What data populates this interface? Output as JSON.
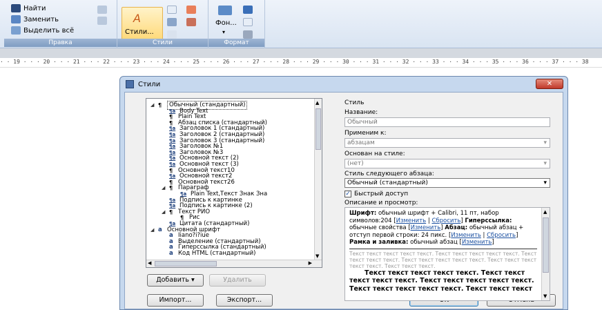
{
  "ribbon": {
    "edit": {
      "find": "Найти",
      "replace": "Заменить",
      "select_all": "Выделить всё",
      "label": "Правка"
    },
    "styles": {
      "button": "Стили...",
      "label": "Стили"
    },
    "format": {
      "background": "Фон...",
      "label": "Формат"
    }
  },
  "ruler": "· · 19 · · · 20 · · · 21 · · · 22 · · · 23 · · · 24 · · · 25 · · · 26 · · · 27 · · · 28 · · · 29 · · · 30 · · · 31 · · · 32 · · · 33 · · · 34 · · · 35 · · · 36 · · · 37 · · · 38",
  "dialog": {
    "title": "Стили",
    "close": "✕",
    "tree": [
      {
        "label": "Обычный (стандартный)",
        "kind": "para",
        "indent": 0,
        "twist": "◢",
        "selected": true
      },
      {
        "label": "Body Text",
        "kind": "char",
        "indent": 1
      },
      {
        "label": "Plain Text",
        "kind": "para",
        "indent": 1
      },
      {
        "label": "Абзац списка (стандартный)",
        "kind": "para",
        "indent": 1
      },
      {
        "label": "Заголовок 1 (стандартный)",
        "kind": "char",
        "indent": 1
      },
      {
        "label": "Заголовок 2 (стандартный)",
        "kind": "char",
        "indent": 1
      },
      {
        "label": "Заголовок 3 (стандартный)",
        "kind": "char",
        "indent": 1
      },
      {
        "label": "Заголовок №1",
        "kind": "char",
        "indent": 1
      },
      {
        "label": "Заголовок №3",
        "kind": "char",
        "indent": 1
      },
      {
        "label": "Основной текст (2)",
        "kind": "char",
        "indent": 1
      },
      {
        "label": "Основной текст (3)",
        "kind": "char",
        "indent": 1
      },
      {
        "label": "Основной текст10",
        "kind": "para",
        "indent": 1
      },
      {
        "label": "Основной текст2",
        "kind": "char",
        "indent": 1
      },
      {
        "label": "Основной текст26",
        "kind": "para",
        "indent": 1
      },
      {
        "label": "Параграф",
        "kind": "para",
        "indent": 1,
        "twist": "◢"
      },
      {
        "label": "Plain Text,Текст Знак Зна",
        "kind": "char",
        "indent": 2
      },
      {
        "label": "Подпись к картинке",
        "kind": "char",
        "indent": 1
      },
      {
        "label": "Подпись к картинке (2)",
        "kind": "char",
        "indent": 1
      },
      {
        "label": "Текст РИО",
        "kind": "para",
        "indent": 1,
        "twist": "◢"
      },
      {
        "label": "Рис",
        "kind": "para",
        "indent": 2
      },
      {
        "label": "Цитата (стандартный)",
        "kind": "char",
        "indent": 1
      },
      {
        "label": "Основной шрифт",
        "kind": "a",
        "indent": 0,
        "twist": "◢"
      },
      {
        "label": "Iiano?i?iue",
        "kind": "a",
        "indent": 1
      },
      {
        "label": "Выделение (стандартный)",
        "kind": "a",
        "indent": 1
      },
      {
        "label": "Гиперссылка (стандартный)",
        "kind": "a",
        "indent": 1
      },
      {
        "label": "Код HTML (стандартный)",
        "kind": "a",
        "indent": 1
      }
    ],
    "buttons": {
      "add": "Добавить ▾",
      "delete": "Удалить",
      "import": "Импорт...",
      "export": "Экспорт...",
      "ok": "OK",
      "cancel": "Отмена"
    },
    "style_panel": {
      "group_title": "Стиль",
      "name_label": "Название:",
      "name_value": "Обычный",
      "apply_label": "Применим к:",
      "apply_value": "абзацам",
      "based_label": "Основан на стиле:",
      "based_value": "(нет)",
      "next_label": "Стиль следующего абзаца:",
      "next_value": "Обычный (стандартный)",
      "quick_access": "Быстрый доступ",
      "desc_label": "Описание и просмотр:"
    },
    "description": {
      "font_b": "Шрифт:",
      "font_t": " обычный шрифт + Calibri, 11 пт, набор символов:204 ",
      "change": "Изменить",
      "reset": "Сбросить",
      "hyper_b": "Гиперссылка:",
      "hyper_t": " обычные свойства ",
      "para_b": "Абзац:",
      "para_t": " обычный абзац + отступ первой строки: 24 пикс. ",
      "frame_b": "Рамка и заливка:",
      "frame_t": " обычный абзац ",
      "grey": "Текст текст текст текст текст. Текст текст текст текст текст. Текст текст текст текст. Текст текст текст текст текст. Текст текст текст текст текст. Текст текст текст.",
      "preview_first": "Текст текст текст текст текст. Текст",
      "preview_rest": "текст текст текст текст. Текст текст текст текст текст. Текст текст текст текст текст. Текст текст текст"
    }
  }
}
